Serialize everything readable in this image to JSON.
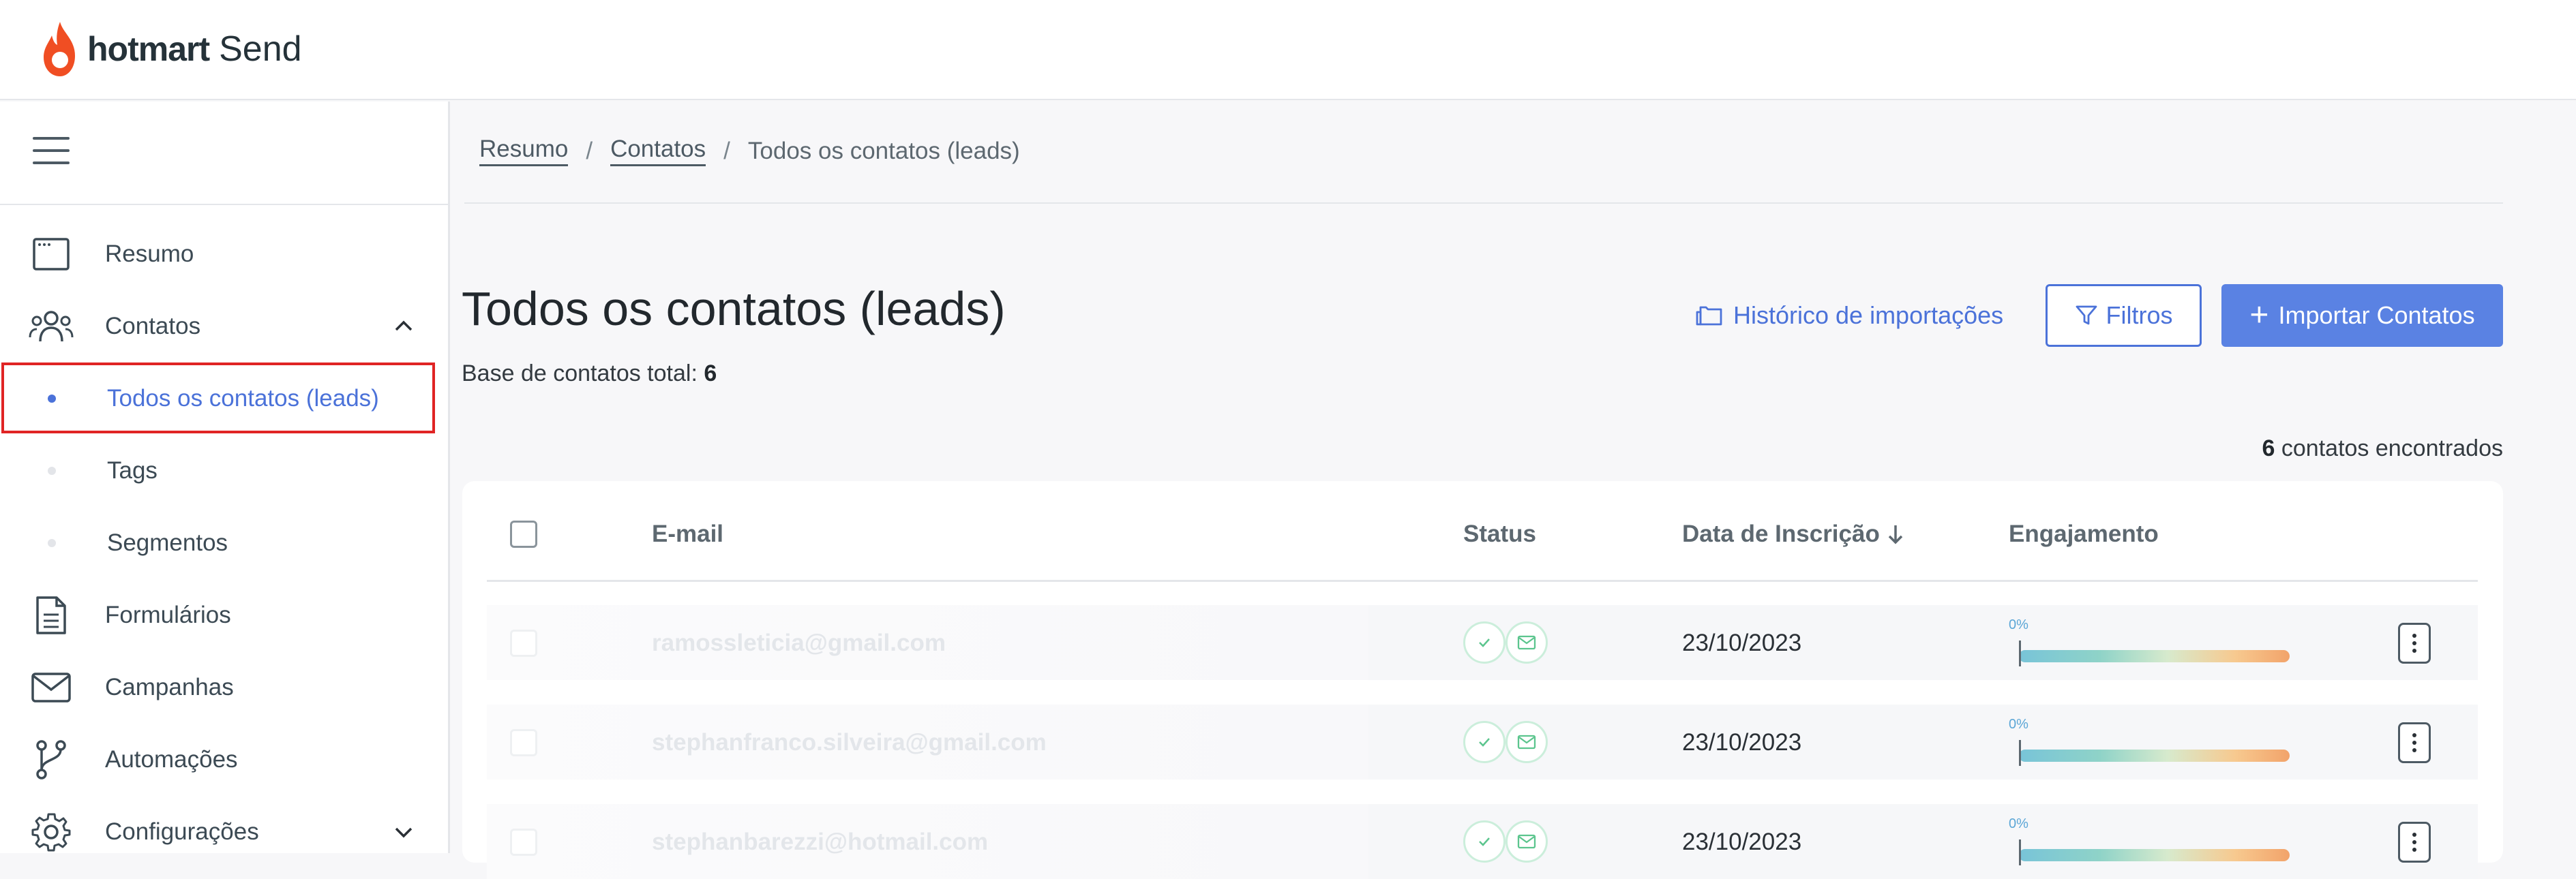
{
  "brand": {
    "name": "hotmart",
    "suffix": "Send"
  },
  "sidebar": {
    "items": [
      {
        "label": "Resumo",
        "icon": "window-icon"
      },
      {
        "label": "Contatos",
        "icon": "users-icon",
        "expanded": true
      },
      {
        "label": "Todos os contatos (leads)",
        "icon": "bullet-dot",
        "active": true
      },
      {
        "label": "Tags",
        "icon": "bullet-dot"
      },
      {
        "label": "Segmentos",
        "icon": "bullet-dot"
      },
      {
        "label": "Formulários",
        "icon": "document-icon"
      },
      {
        "label": "Campanhas",
        "icon": "envelope-icon"
      },
      {
        "label": "Automações",
        "icon": "branch-icon"
      },
      {
        "label": "Configurações",
        "icon": "gear-icon",
        "expanded": false
      }
    ]
  },
  "breadcrumb": {
    "items": [
      "Resumo",
      "Contatos"
    ],
    "current": "Todos os contatos (leads)",
    "separator": "/"
  },
  "page": {
    "title": "Todos os contatos (leads)",
    "base_total_label": "Base de contatos total:",
    "base_total_value": "6",
    "history_link": "Histórico de importações",
    "filters_button": "Filtros",
    "import_button": "Importar Contatos",
    "found_count": "6",
    "found_label": "contatos encontrados"
  },
  "table": {
    "columns": {
      "email": "E-mail",
      "status": "Status",
      "date": "Data de Inscrição",
      "engagement": "Engajamento"
    },
    "rows": [
      {
        "email": "ramossleticia@gmail.com",
        "date": "23/10/2023",
        "engagement": "0%"
      },
      {
        "email": "stephanfranco.silveira@gmail.com",
        "date": "23/10/2023",
        "engagement": "0%"
      },
      {
        "email": "stephanbarezzi@hotmail.com",
        "date": "23/10/2023",
        "engagement": "0%"
      }
    ]
  },
  "colors": {
    "accent": "#4b72d9",
    "primary_button": "#5a82e3",
    "brand_flame": "#f04e23",
    "highlight_outline": "#e02424"
  }
}
